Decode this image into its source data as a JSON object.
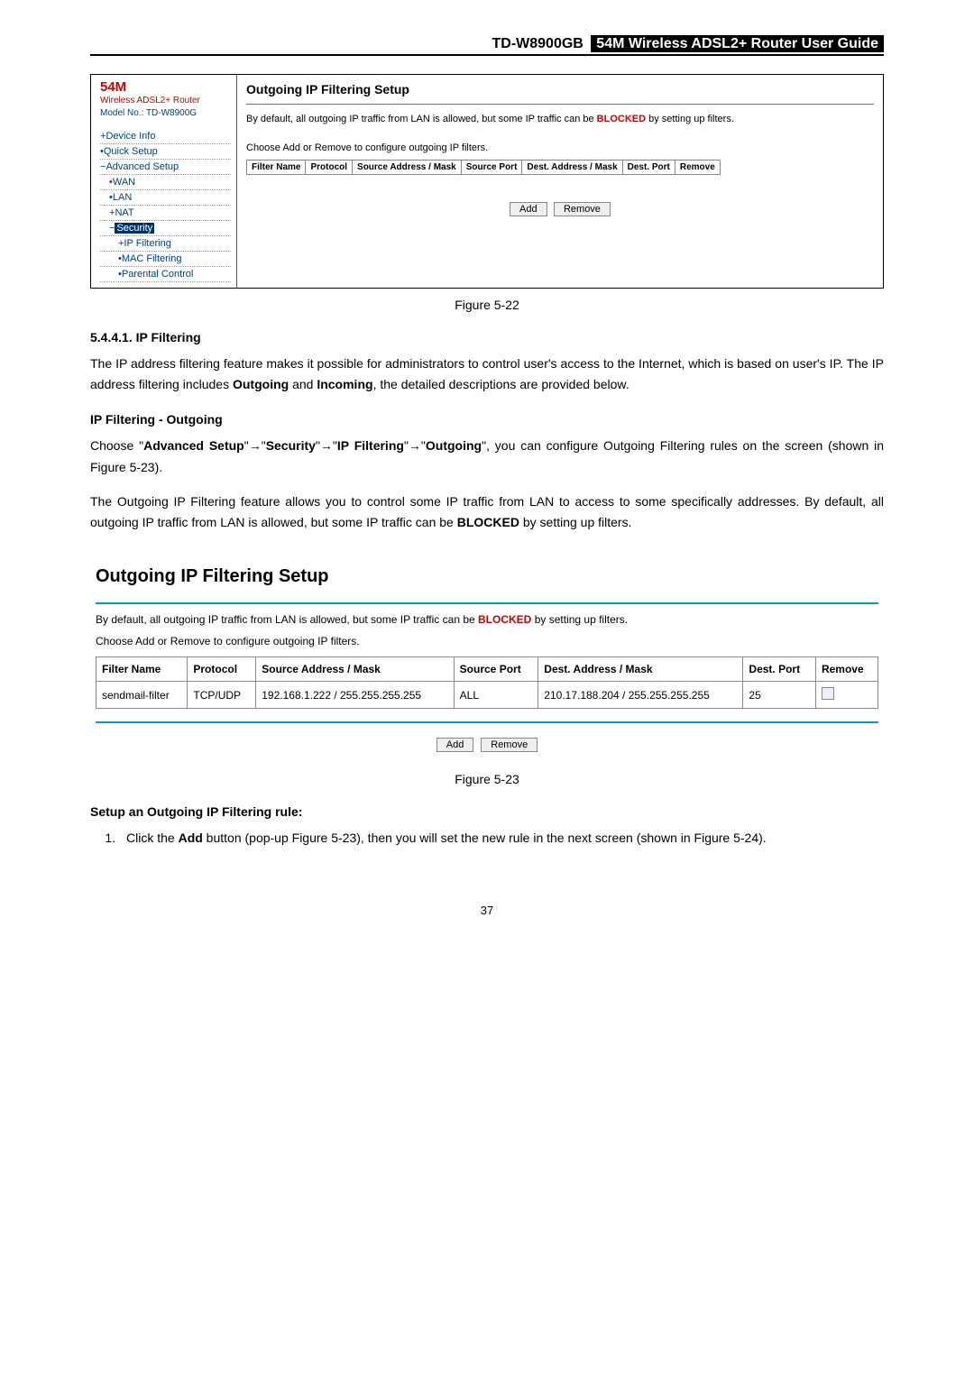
{
  "header": {
    "model": "TD-W8900GB",
    "title": "54M Wireless ADSL2+ Router User Guide"
  },
  "fig22": {
    "brand_big": "54M",
    "brand_line1": "Wireless ADSL2+ Router",
    "brand_line2": "Model No.: TD-W8900G",
    "nav": {
      "device_info": "Device Info",
      "quick_setup": "Quick Setup",
      "advanced_setup": "Advanced Setup",
      "wan": "WAN",
      "lan": "LAN",
      "nat": "NAT",
      "security": "Security",
      "ip_filtering": "IP Filtering",
      "mac_filtering": "MAC Filtering",
      "parental_control": "Parental Control"
    },
    "panel_heading": "Outgoing IP Filtering Setup",
    "desc_prefix": "By default, all outgoing IP traffic from LAN is allowed, but some IP traffic can be ",
    "desc_blocked": "BLOCKED",
    "desc_suffix": " by setting up filters.",
    "desc2": "Choose Add or Remove to configure outgoing IP filters.",
    "cols": {
      "c1": "Filter Name",
      "c2": "Protocol",
      "c3": "Source Address / Mask",
      "c4": "Source Port",
      "c5": "Dest. Address / Mask",
      "c6": "Dest. Port",
      "c7": "Remove"
    },
    "add_btn": "Add",
    "remove_btn": "Remove",
    "caption": "Figure 5-22"
  },
  "sec5441": {
    "heading": "5.4.4.1.  IP Filtering",
    "para1_a": "The IP address filtering feature makes it possible for administrators to control user's access to the Internet, which is based on user's IP. The IP address filtering includes ",
    "para1_b": "Outgoing",
    "para1_c": " and ",
    "para1_d": "Incoming",
    "para1_e": ", the detailed descriptions are provided below.",
    "sub_heading": "IP Filtering - Outgoing",
    "para2_a": "Choose \"",
    "para2_b": "Advanced Setup",
    "para2_c": "\"→\"",
    "para2_d": "Security",
    "para2_e": "\"→\"",
    "para2_f": "IP Filtering",
    "para2_g": "\"→\"",
    "para2_h": "Outgoing",
    "para2_i": "\", you can configure Outgoing Filtering rules on the screen (shown in Figure 5-23).",
    "para3_a": "The Outgoing IP Filtering feature allows you to control some IP traffic from LAN to access to some specifically addresses. By default, all outgoing IP traffic from LAN is allowed, but some IP traffic can be ",
    "para3_b": "BLOCKED",
    "para3_c": " by setting up filters."
  },
  "fig23": {
    "heading": "Outgoing IP Filtering Setup",
    "desc_prefix": "By default, all outgoing IP traffic from LAN is allowed, but some IP traffic can be ",
    "desc_blocked": "BLOCKED",
    "desc_suffix": " by setting up filters.",
    "desc2": "Choose Add or Remove to configure outgoing IP filters.",
    "cols": {
      "c1": "Filter Name",
      "c2": "Protocol",
      "c3": "Source Address / Mask",
      "c4": "Source Port",
      "c5": "Dest. Address / Mask",
      "c6": "Dest. Port",
      "c7": "Remove"
    },
    "row1": {
      "name": "sendmail-filter",
      "proto": "TCP/UDP",
      "src": "192.168.1.222 / 255.255.255.255",
      "sport": "ALL",
      "dst": "210.17.188.204 / 255.255.255.255",
      "dport": "25"
    },
    "add_btn": "Add",
    "remove_btn": "Remove",
    "caption": "Figure 5-23"
  },
  "setup_rule": {
    "heading": "Setup an Outgoing IP Filtering rule:",
    "step1_a": "Click the ",
    "step1_b": "Add",
    "step1_c": " button (pop-up Figure 5-23), then you will set the new rule in the next screen (shown in Figure 5-24)."
  },
  "page_number": "37"
}
